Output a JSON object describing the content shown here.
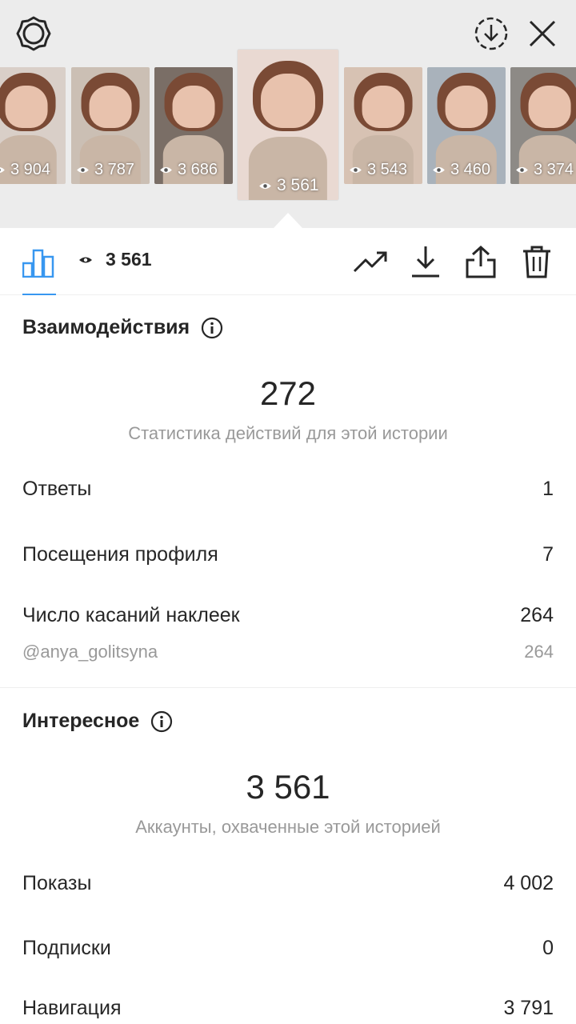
{
  "stories": [
    {
      "views": "3 904",
      "bg": "#d9cfc8"
    },
    {
      "views": "3 787",
      "bg": "#cbbfb4"
    },
    {
      "views": "3 686",
      "bg": "#7a6e66"
    },
    {
      "views": "3 561",
      "bg": "#e9d9d2"
    },
    {
      "views": "3 543",
      "bg": "#d7c2b3"
    },
    {
      "views": "3 460",
      "bg": "#a9b2bb"
    },
    {
      "views": "3 374",
      "bg": "#8d8a86"
    }
  ],
  "header": {
    "settings_icon": "settings-icon",
    "save_icon": "download-circle-icon",
    "close_icon": "close-icon"
  },
  "action_bar": {
    "views": "3 561",
    "icons": [
      "bar-chart-icon",
      "eye-icon",
      "trend-icon",
      "download-icon",
      "share-icon",
      "trash-icon"
    ]
  },
  "interactions": {
    "title": "Взаимодействия",
    "total": "272",
    "caption": "Статистика действий для этой истории",
    "rows": [
      {
        "label": "Ответы",
        "value": "1"
      },
      {
        "label": "Посещения профиля",
        "value": "7"
      },
      {
        "label": "Число касаний наклеек",
        "value": "264"
      }
    ],
    "sticker": {
      "label": "@anya_golitsyna",
      "value": "264"
    }
  },
  "discovery": {
    "title": "Интересное",
    "total": "3 561",
    "caption": "Аккаунты, охваченные этой историей",
    "rows": [
      {
        "label": "Показы",
        "value": "4 002"
      },
      {
        "label": "Подписки",
        "value": "0"
      },
      {
        "label": "Навигация",
        "value": "3 791"
      }
    ]
  },
  "colors": {
    "accent": "#3897f0",
    "text": "#262626",
    "secondary": "#999999",
    "top_background": "#ececec"
  }
}
